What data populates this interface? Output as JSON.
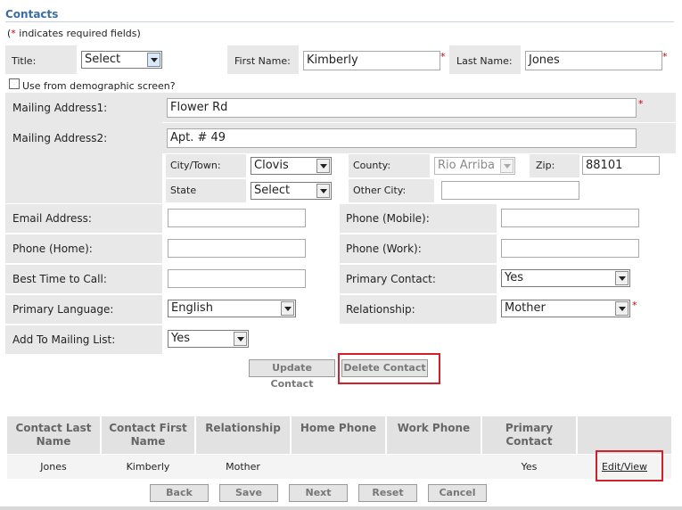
{
  "header": {
    "title": "Contacts",
    "required_note_prefix": "(",
    "required_note_star": "*",
    "required_note_suffix": " indicates required fields)"
  },
  "form": {
    "title_label": "Title:",
    "title_value": "Select",
    "first_name_label": "First Name:",
    "first_name_value": "Kimberly",
    "last_name_label": "Last Name:",
    "last_name_value": "Jones",
    "use_demographic_label": "Use from demographic screen?",
    "mailing_address1_label": "Mailing Address1:",
    "mailing_address1_value": "Flower Rd",
    "mailing_address2_label": "Mailing Address2:",
    "mailing_address2_value": "Apt. # 49",
    "city_label": "City/Town:",
    "city_value": "Clovis",
    "county_label": "County:",
    "county_value": "Rio Arriba",
    "zip_label": "Zip:",
    "zip_value": "88101",
    "state_label": "State",
    "state_value": "Select",
    "other_city_label": "Other City:",
    "other_city_value": "",
    "email_label": "Email Address:",
    "email_value": "",
    "phone_mobile_label": "Phone (Mobile):",
    "phone_mobile_value": "",
    "phone_home_label": "Phone (Home):",
    "phone_home_value": "",
    "phone_work_label": "Phone (Work):",
    "phone_work_value": "",
    "best_time_label": "Best Time to Call:",
    "best_time_value": "",
    "primary_contact_label": "Primary Contact:",
    "primary_contact_value": "Yes",
    "primary_language_label": "Primary Language:",
    "primary_language_value": "English",
    "relationship_label": "Relationship:",
    "relationship_value": "Mother",
    "mailing_list_label": "Add To Mailing List:",
    "mailing_list_value": "Yes",
    "required_star": "*"
  },
  "actions": {
    "update_label": "Update Contact",
    "delete_label": "Delete Contact"
  },
  "table": {
    "headers": [
      "Contact Last Name",
      "Contact First Name",
      "Relationship",
      "Home Phone",
      "Work Phone",
      "Primary Contact",
      ""
    ],
    "rows": [
      {
        "last_name": "Jones",
        "first_name": "Kimberly",
        "relationship": "Mother",
        "home_phone": "",
        "work_phone": "",
        "primary_contact": "Yes",
        "action": "Edit/View"
      }
    ]
  },
  "nav": {
    "back": "Back",
    "save": "Save",
    "next": "Next",
    "reset": "Reset",
    "cancel": "Cancel"
  },
  "colors": {
    "title_blue": "#3a6ea5",
    "panel_gray": "#e8e8e8",
    "highlight_red": "#d0202a",
    "required_red": "#cc0000"
  }
}
